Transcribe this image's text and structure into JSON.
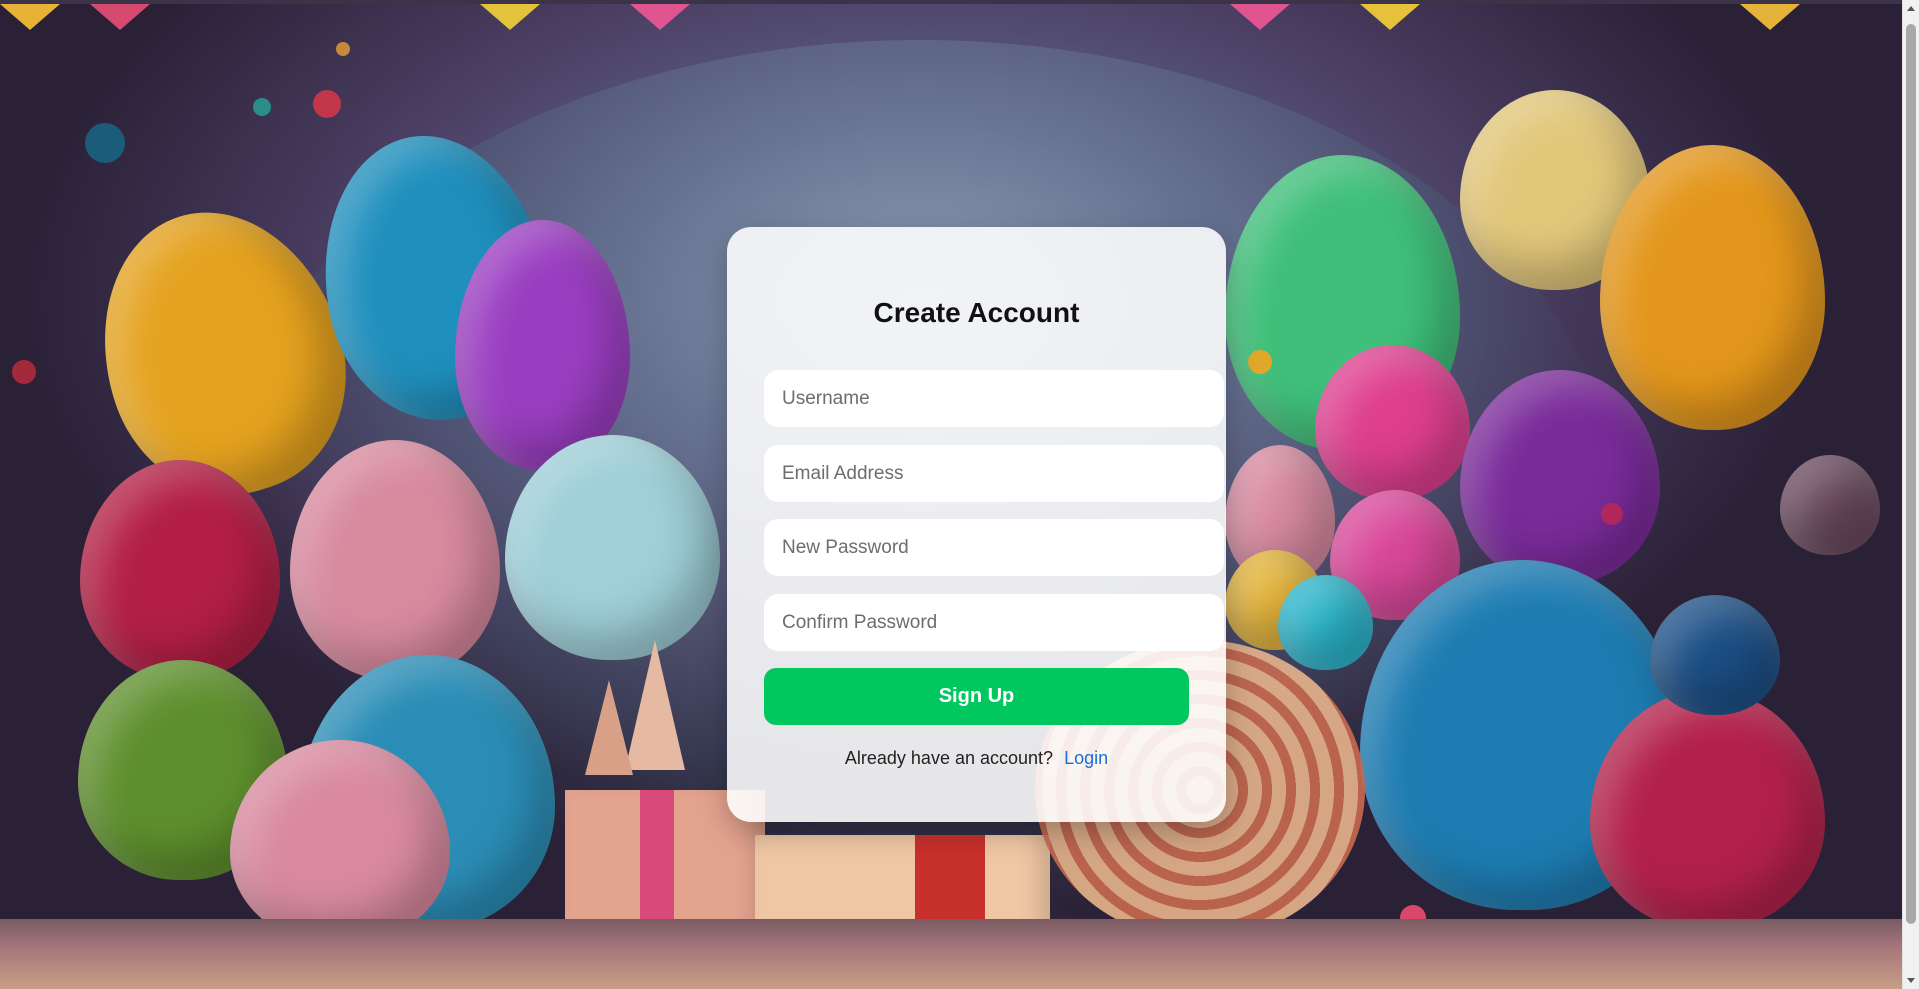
{
  "form": {
    "title": "Create Account",
    "username_placeholder": "Username",
    "email_placeholder": "Email Address",
    "new_password_placeholder": "New Password",
    "confirm_password_placeholder": "Confirm Password",
    "signup_label": "Sign Up",
    "login_prompt": "Already have an account?",
    "login_link": "Login"
  },
  "colors": {
    "accent_button": "#00c85f",
    "link": "#1a6fd8",
    "card_background": "rgba(255,255,255,0.88)"
  },
  "background": {
    "icons": [
      "balloon-icon",
      "gift-icon",
      "party-hat-icon",
      "bunting-flag-icon",
      "confetti-icon"
    ]
  }
}
